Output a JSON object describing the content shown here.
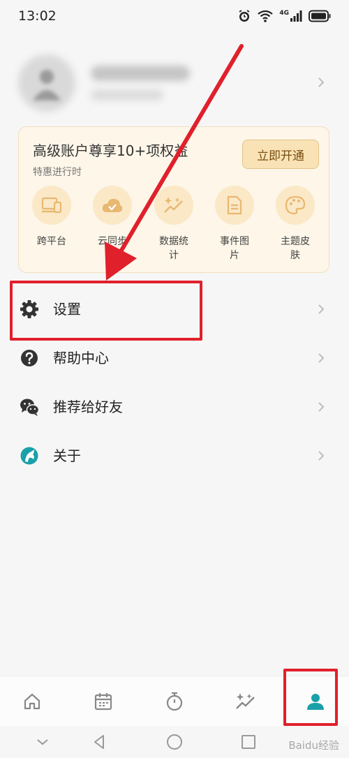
{
  "status_bar": {
    "time": "13:02",
    "icons": [
      "alarm-icon",
      "wifi-icon",
      "signal-4g-icon",
      "battery-icon"
    ],
    "network_label": "4G"
  },
  "profile": {
    "avatar_icon": "user-avatar-icon",
    "name_blurred": true
  },
  "premium": {
    "title": "高级账户尊享10+项权益",
    "subtitle": "特惠进行时",
    "button_label": "立即开通",
    "features": [
      {
        "label": "跨平台",
        "icon": "devices-icon"
      },
      {
        "label": "云同步",
        "icon": "cloud-check-icon"
      },
      {
        "label": "数据统计",
        "icon": "sparkle-chart-icon"
      },
      {
        "label": "事件图片",
        "icon": "document-icon"
      },
      {
        "label": "主题皮肤",
        "icon": "palette-icon"
      }
    ]
  },
  "menu": [
    {
      "label": "设置",
      "icon": "gear-icon"
    },
    {
      "label": "帮助中心",
      "icon": "question-icon"
    },
    {
      "label": "推荐给好友",
      "icon": "wechat-icon"
    },
    {
      "label": "关于",
      "icon": "app-logo-icon"
    }
  ],
  "tab_bar": {
    "tabs": [
      {
        "icon": "home-icon",
        "active": false
      },
      {
        "icon": "calendar-icon",
        "active": false
      },
      {
        "icon": "timer-icon",
        "active": false
      },
      {
        "icon": "stats-icon",
        "active": false
      },
      {
        "icon": "profile-icon",
        "active": true
      }
    ]
  },
  "nav_bar": {
    "buttons": [
      "collapse-icon",
      "back-icon",
      "home-circle-icon",
      "recents-icon"
    ]
  },
  "watermark": "Baidu经验",
  "colors": {
    "accent": "#1aa0a8",
    "annotation": "#e0202b",
    "card_bg": "#fdf6e9",
    "feature_icon": "#e8b871",
    "button_bg": "#f9e3b6"
  }
}
